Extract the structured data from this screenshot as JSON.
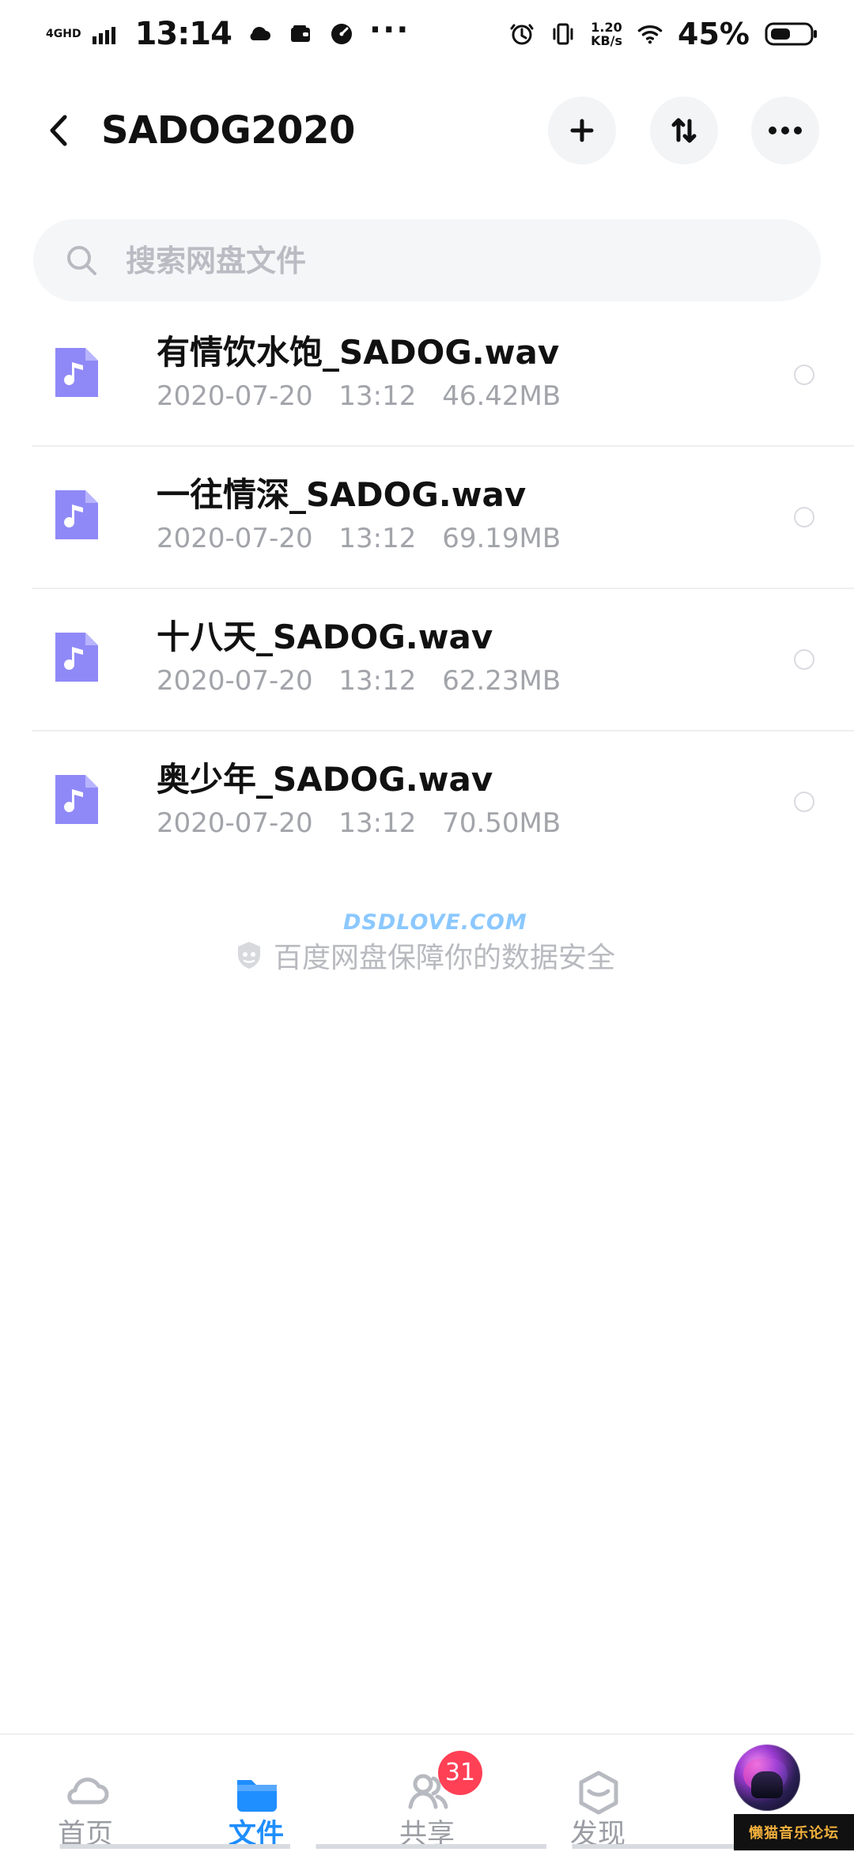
{
  "status_bar": {
    "network": "4GHD",
    "time": "13:14",
    "dots": "···",
    "speed_value": "1.20",
    "speed_unit": "KB/s",
    "battery": "45%"
  },
  "header": {
    "title": "SADOG2020"
  },
  "search": {
    "placeholder": "搜索网盘文件"
  },
  "files": [
    {
      "name": "有情饮水饱_SADOG.wav",
      "date": "2020-07-20",
      "time": "13:12",
      "size": "46.42MB"
    },
    {
      "name": "一往情深_SADOG.wav",
      "date": "2020-07-20",
      "time": "13:12",
      "size": "69.19MB"
    },
    {
      "name": "十八天_SADOG.wav",
      "date": "2020-07-20",
      "time": "13:12",
      "size": "62.23MB"
    },
    {
      "name": "奥少年_SADOG.wav",
      "date": "2020-07-20",
      "time": "13:12",
      "size": "70.50MB"
    }
  ],
  "footer": {
    "security_text": "百度网盘保障你的数据安全",
    "watermark": "DSDLOVE.COM"
  },
  "tabs": [
    {
      "label": "首页",
      "icon": "cloud-icon",
      "active": false
    },
    {
      "label": "文件",
      "icon": "folder-icon",
      "active": true
    },
    {
      "label": "共享",
      "icon": "people-icon",
      "active": false,
      "badge": "31"
    },
    {
      "label": "发现",
      "icon": "discover-icon",
      "active": false
    }
  ],
  "corner_watermark": "懒猫音乐论坛",
  "colors": {
    "accent": "#1f8eff",
    "file_icon": "#8f89f7",
    "badge": "#ff4055"
  }
}
